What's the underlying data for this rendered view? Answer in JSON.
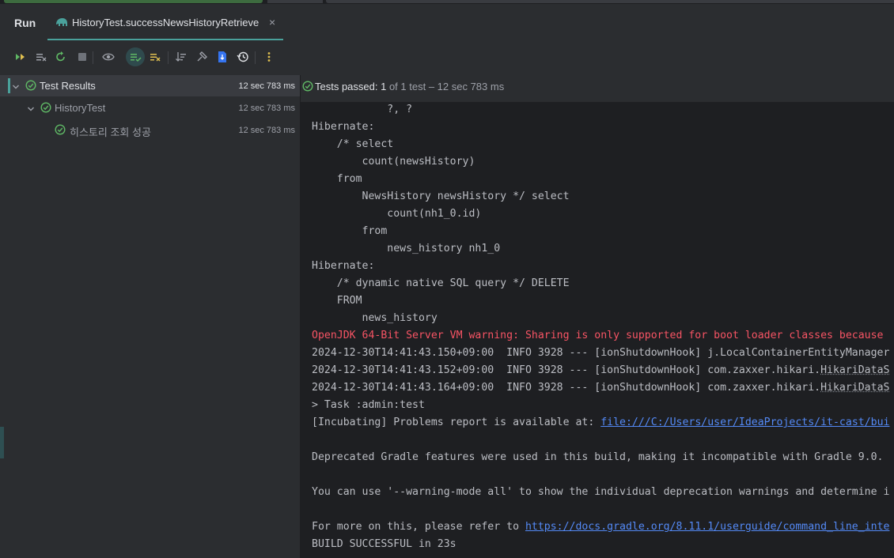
{
  "header": {
    "run_label": "Run",
    "tab_title": "HistoryTest.successNewsHistoryRetrieve",
    "tab_close": "×"
  },
  "toolbar": {
    "buttons": [
      "rerun-icon",
      "rerun-failed-icon",
      "toggle-autotest-icon",
      "stop-icon",
      "show-passed-icon",
      "show-ignored-icon",
      "sort-icon",
      "collapse-icon",
      "export-icon",
      "history-icon",
      "more-icon"
    ]
  },
  "tree": {
    "root": {
      "label": "Test Results",
      "duration": "12 sec 783 ms"
    },
    "suite": {
      "label": "HistoryTest",
      "duration": "12 sec 783 ms"
    },
    "test": {
      "label": "히스토리 조회 성공",
      "duration": "12 sec 783 ms"
    }
  },
  "status": {
    "prefix": "Tests passed: ",
    "count": "1",
    "rest": " of 1 test – 12 sec 783 ms"
  },
  "console": {
    "l01": "            ?, ?",
    "l02": "Hibernate: ",
    "l03": "    /* select",
    "l04": "        count(newsHistory) ",
    "l05": "    from",
    "l06": "        NewsHistory newsHistory */ select",
    "l07": "            count(nh1_0.id) ",
    "l08": "        from",
    "l09": "            news_history nh1_0",
    "l10": "Hibernate: ",
    "l11": "    /* dynamic native SQL query */ DELETE ",
    "l12": "    FROM",
    "l13": "        news_history",
    "l14": "OpenJDK 64-Bit Server VM warning: Sharing is only supported for boot loader classes because",
    "l15a": "2024-12-30T14:41:43.150+09:00  INFO 3928 --- [ionShutdownHook] j.LocalContainerEntityManager",
    "l16a": "2024-12-30T14:41:43.152+09:00  INFO 3928 --- [ionShutdownHook] com.zaxxer.hikari.",
    "l16b": "HikariDataS",
    "l17a": "2024-12-30T14:41:43.164+09:00  INFO 3928 --- [ionShutdownHook] com.zaxxer.hikari.",
    "l17b": "HikariDataS",
    "l18": "> Task :admin:test",
    "l19a": "[Incubating] Problems report is available at: ",
    "l19b": "file:///C:/Users/user/IdeaProjects/it-cast/bui",
    "l20": "Deprecated Gradle features were used in this build, making it incompatible with Gradle 9.0.",
    "l21": "You can use '--warning-mode all' to show the individual deprecation warnings and determine i",
    "l22a": "For more on this, please refer to ",
    "l22b": "https://docs.gradle.org/8.11.1/userguide/command_line_inte",
    "l23": "BUILD SUCCESSFUL in 23s"
  },
  "colors": {
    "accent": "#4aa19b",
    "error": "#f75464",
    "link": "#548af7",
    "success": "#5fb865"
  }
}
